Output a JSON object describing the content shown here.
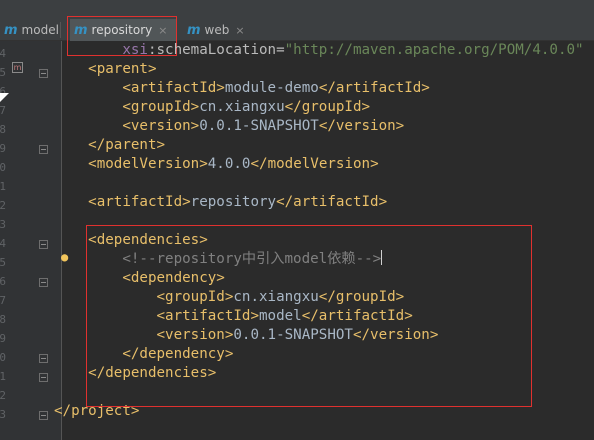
{
  "tabs": [
    {
      "label": "model",
      "icon": "m",
      "active": false
    },
    {
      "label": "repository",
      "icon": "m",
      "active": true
    },
    {
      "label": "web",
      "icon": "m",
      "active": false
    }
  ],
  "close_glyph": "×",
  "gutter": {
    "line_numbers": [
      "4",
      "5",
      "6",
      "7",
      "8",
      "9",
      "0",
      "1",
      "2",
      "3",
      "4",
      "5",
      "6",
      "7",
      "8",
      "9",
      "0",
      "1",
      "2",
      "3"
    ]
  },
  "editor": {
    "lines": [
      {
        "indent": "        ",
        "parts": [
          {
            "cls": "ns",
            "t": "xsi"
          },
          {
            "cls": "attr",
            "t": ":schemaLocation="
          },
          {
            "cls": "str",
            "t": "\"http://maven.apache.org/POM/4.0.0\""
          }
        ]
      },
      {
        "indent": "    ",
        "parts": [
          {
            "cls": "tag",
            "t": "<parent>"
          }
        ]
      },
      {
        "indent": "        ",
        "parts": [
          {
            "cls": "tag",
            "t": "<artifactId>"
          },
          {
            "cls": "text",
            "t": "module-demo"
          },
          {
            "cls": "tag",
            "t": "</artifactId>"
          }
        ]
      },
      {
        "indent": "        ",
        "parts": [
          {
            "cls": "tag",
            "t": "<groupId>"
          },
          {
            "cls": "text",
            "t": "cn.xiangxu"
          },
          {
            "cls": "tag",
            "t": "</groupId>"
          }
        ]
      },
      {
        "indent": "        ",
        "parts": [
          {
            "cls": "tag",
            "t": "<version>"
          },
          {
            "cls": "text",
            "t": "0.0.1-SNAPSHOT"
          },
          {
            "cls": "tag",
            "t": "</version>"
          }
        ]
      },
      {
        "indent": "    ",
        "parts": [
          {
            "cls": "tag",
            "t": "</parent>"
          }
        ]
      },
      {
        "indent": "    ",
        "parts": [
          {
            "cls": "tag",
            "t": "<modelVersion>"
          },
          {
            "cls": "text",
            "t": "4.0.0"
          },
          {
            "cls": "tag",
            "t": "</modelVersion>"
          }
        ]
      },
      {
        "indent": "",
        "parts": []
      },
      {
        "indent": "    ",
        "parts": [
          {
            "cls": "tag",
            "t": "<artifactId>"
          },
          {
            "cls": "text",
            "t": "repository"
          },
          {
            "cls": "tag",
            "t": "</artifactId>"
          }
        ]
      },
      {
        "indent": "",
        "parts": []
      },
      {
        "indent": "    ",
        "parts": [
          {
            "cls": "tag",
            "t": "<dependencies>"
          }
        ]
      },
      {
        "indent": "        ",
        "parts": [
          {
            "cls": "comment",
            "t": "<!--repository中引入model依赖-->"
          }
        ],
        "caret": true
      },
      {
        "indent": "        ",
        "parts": [
          {
            "cls": "tag",
            "t": "<dependency>"
          }
        ]
      },
      {
        "indent": "            ",
        "parts": [
          {
            "cls": "tag",
            "t": "<groupId>"
          },
          {
            "cls": "text",
            "t": "cn.xiangxu"
          },
          {
            "cls": "tag",
            "t": "</groupId>"
          }
        ]
      },
      {
        "indent": "            ",
        "parts": [
          {
            "cls": "tag",
            "t": "<artifactId>"
          },
          {
            "cls": "text",
            "t": "model"
          },
          {
            "cls": "tag",
            "t": "</artifactId>"
          }
        ]
      },
      {
        "indent": "            ",
        "parts": [
          {
            "cls": "tag",
            "t": "<version>"
          },
          {
            "cls": "text",
            "t": "0.0.1-SNAPSHOT"
          },
          {
            "cls": "tag",
            "t": "</version>"
          }
        ]
      },
      {
        "indent": "        ",
        "parts": [
          {
            "cls": "tag",
            "t": "</dependency>"
          }
        ]
      },
      {
        "indent": "    ",
        "parts": [
          {
            "cls": "tag",
            "t": "</dependencies>"
          }
        ]
      },
      {
        "indent": "",
        "parts": []
      },
      {
        "indent": "",
        "parts": [
          {
            "cls": "tag",
            "t": "</project>"
          }
        ]
      }
    ]
  },
  "colors": {
    "tag": "#e8bf6a",
    "text": "#a9b7c6",
    "string": "#6a8759",
    "comment": "#808080",
    "namespace": "#9876aa",
    "highlight_box": "#e0312f",
    "background": "#2b2b2b"
  },
  "icons": [
    "maven-file-icon",
    "intention-bulb-icon",
    "fold-marker-icon",
    "mouse-pointer-icon"
  ]
}
